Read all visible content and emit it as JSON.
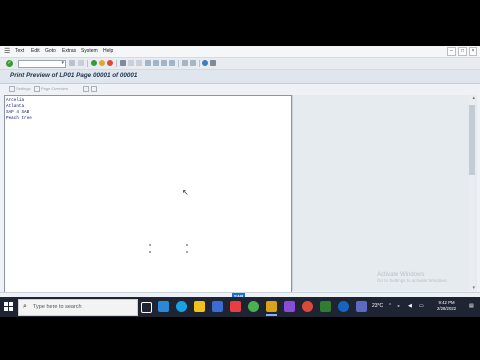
{
  "menu": {
    "items": [
      "Text",
      "Edit",
      "Goto",
      "Extras",
      "System",
      "Help"
    ]
  },
  "header": {
    "title": "Print Preview of LP01 Page 00001 of 00001"
  },
  "app_toolbar": {
    "buttons": [
      "Settings",
      "Page Overview"
    ]
  },
  "document": {
    "lines": [
      "Arcelia",
      "Atlanta",
      "SAP 4 SAB",
      "Peach tree"
    ]
  },
  "watermark": {
    "line1": "Activate Windows",
    "line2": "Go to Settings to activate Windows."
  },
  "footer": {
    "logo": "SAP"
  },
  "taskbar": {
    "search_placeholder": "Type here to search",
    "temperature": "23°C",
    "time": "9:42 PM",
    "date": "2/28/2022"
  },
  "colors": {
    "title_text": "#23354d",
    "doc_text": "#10107a",
    "sap_blue": "#1a6fd0",
    "taskbar_bg": "#1f2432"
  }
}
